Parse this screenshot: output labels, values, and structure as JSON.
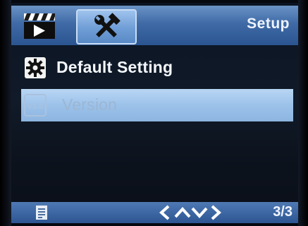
{
  "header": {
    "tabs": [
      {
        "icon": "video-clapper-icon",
        "active": false
      },
      {
        "icon": "setup-tools-icon",
        "active": true
      }
    ],
    "title": "Setup"
  },
  "menu": {
    "items": [
      {
        "icon": "gear-icon",
        "label": "Default Setting",
        "selected": false
      },
      {
        "icon": "version-badge-icon",
        "icon_text": "V1.0",
        "label": "Version",
        "selected": true
      }
    ]
  },
  "footer": {
    "left_icon": "document-icon",
    "nav_icon": "left-up-down-right-arrows-icon",
    "page": "3/3"
  },
  "colors": {
    "bar_blue": "#3f6aa5",
    "active_tab": "#6f9dd5",
    "selection": "#9cc2ea",
    "text": "#f4f7fb",
    "selected_text": "#9cb6d3"
  }
}
